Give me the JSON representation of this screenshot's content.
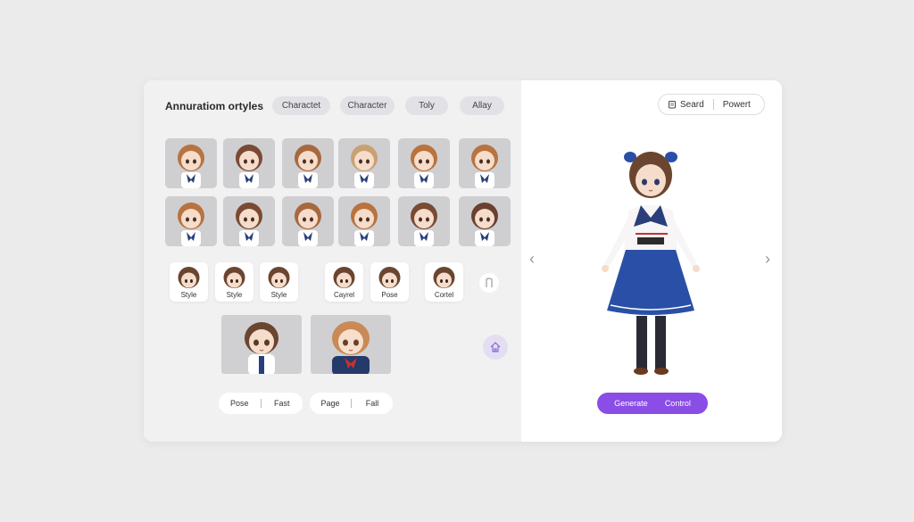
{
  "header": {
    "title": "Annuratiom ortyles"
  },
  "tabs": [
    {
      "label": "Charactet"
    },
    {
      "label": "Character"
    },
    {
      "label": "Toly"
    },
    {
      "label": "Allay"
    }
  ],
  "character_grid": {
    "hair_colors": [
      "#b8733f",
      "#7a4a33",
      "#a8683e",
      "#c9a070",
      "#b8733f",
      "#b8733f",
      "#b8733f",
      "#7a4a33",
      "#a8683e",
      "#b8733f",
      "#7a4a33",
      "#6a4030"
    ]
  },
  "style_chips": [
    {
      "label": "Style"
    },
    {
      "label": "Style"
    },
    {
      "label": "Style"
    },
    {
      "label": "Cayrel"
    },
    {
      "label": "Pose"
    },
    {
      "label": "Cortel"
    }
  ],
  "pill_groups": [
    {
      "left": "Pose",
      "right": "Fast"
    },
    {
      "left": "Page",
      "right": "Fall"
    }
  ],
  "toolbar": {
    "search_label": "Seard",
    "power_label": "Powert"
  },
  "actions": {
    "generate_label": "Generate",
    "control_label": "Control"
  },
  "icons": {
    "search": "clipboard-icon",
    "home": "home-icon",
    "bookmark": "bookmark-icon",
    "prev": "chevron-left-icon",
    "next": "chevron-right-icon"
  },
  "colors": {
    "accent": "#8a4de6",
    "skirt": "#2a4fa6",
    "panel_bg": "#f1f1f1"
  }
}
